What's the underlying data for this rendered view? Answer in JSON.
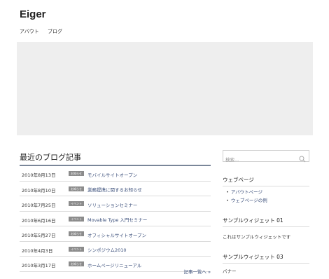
{
  "header": {
    "site_title": "Eiger"
  },
  "nav": {
    "items": [
      "アバウト",
      "ブログ"
    ]
  },
  "main": {
    "title": "最近のブログ記事",
    "entries": [
      {
        "date": "2010年8月13日",
        "badge": "お知らせ",
        "title": "モバイルサイトオープン"
      },
      {
        "date": "2010年8月10日",
        "badge": "お知らせ",
        "title": "業務提携に関するお知らせ"
      },
      {
        "date": "2010年7月25日",
        "badge": "イベント",
        "title": "ソリューションセミナー"
      },
      {
        "date": "2010年6月16日",
        "badge": "イベント",
        "title": "Movable Type 入門セミナー"
      },
      {
        "date": "2010年5月27日",
        "badge": "お知らせ",
        "title": "オフィシャルサイトオープン"
      },
      {
        "date": "2010年4月3日",
        "badge": "イベント",
        "title": "シンポジウム2010"
      },
      {
        "date": "2010年3月17日",
        "badge": "お知らせ",
        "title": "ホームページリニューアル"
      }
    ],
    "more_link": "記事一覧へ »"
  },
  "sidebar": {
    "search_placeholder": "検索...",
    "search_icon": "search-icon",
    "webpages": {
      "title": "ウェブページ",
      "items": [
        "アバウトページ",
        "ウェブページの例"
      ]
    },
    "widget01": {
      "title": "サンプルウィジェット 01",
      "text": "これはサンプルウィジェットです"
    },
    "widget03": {
      "title": "サンプルウィジェット 03",
      "text": "バナー"
    }
  },
  "colors": {
    "accent_rule": "#7a8699",
    "link": "#3a4e7a",
    "badge_bg": "#8c8c8c",
    "hero_bg": "#eeeeee"
  }
}
